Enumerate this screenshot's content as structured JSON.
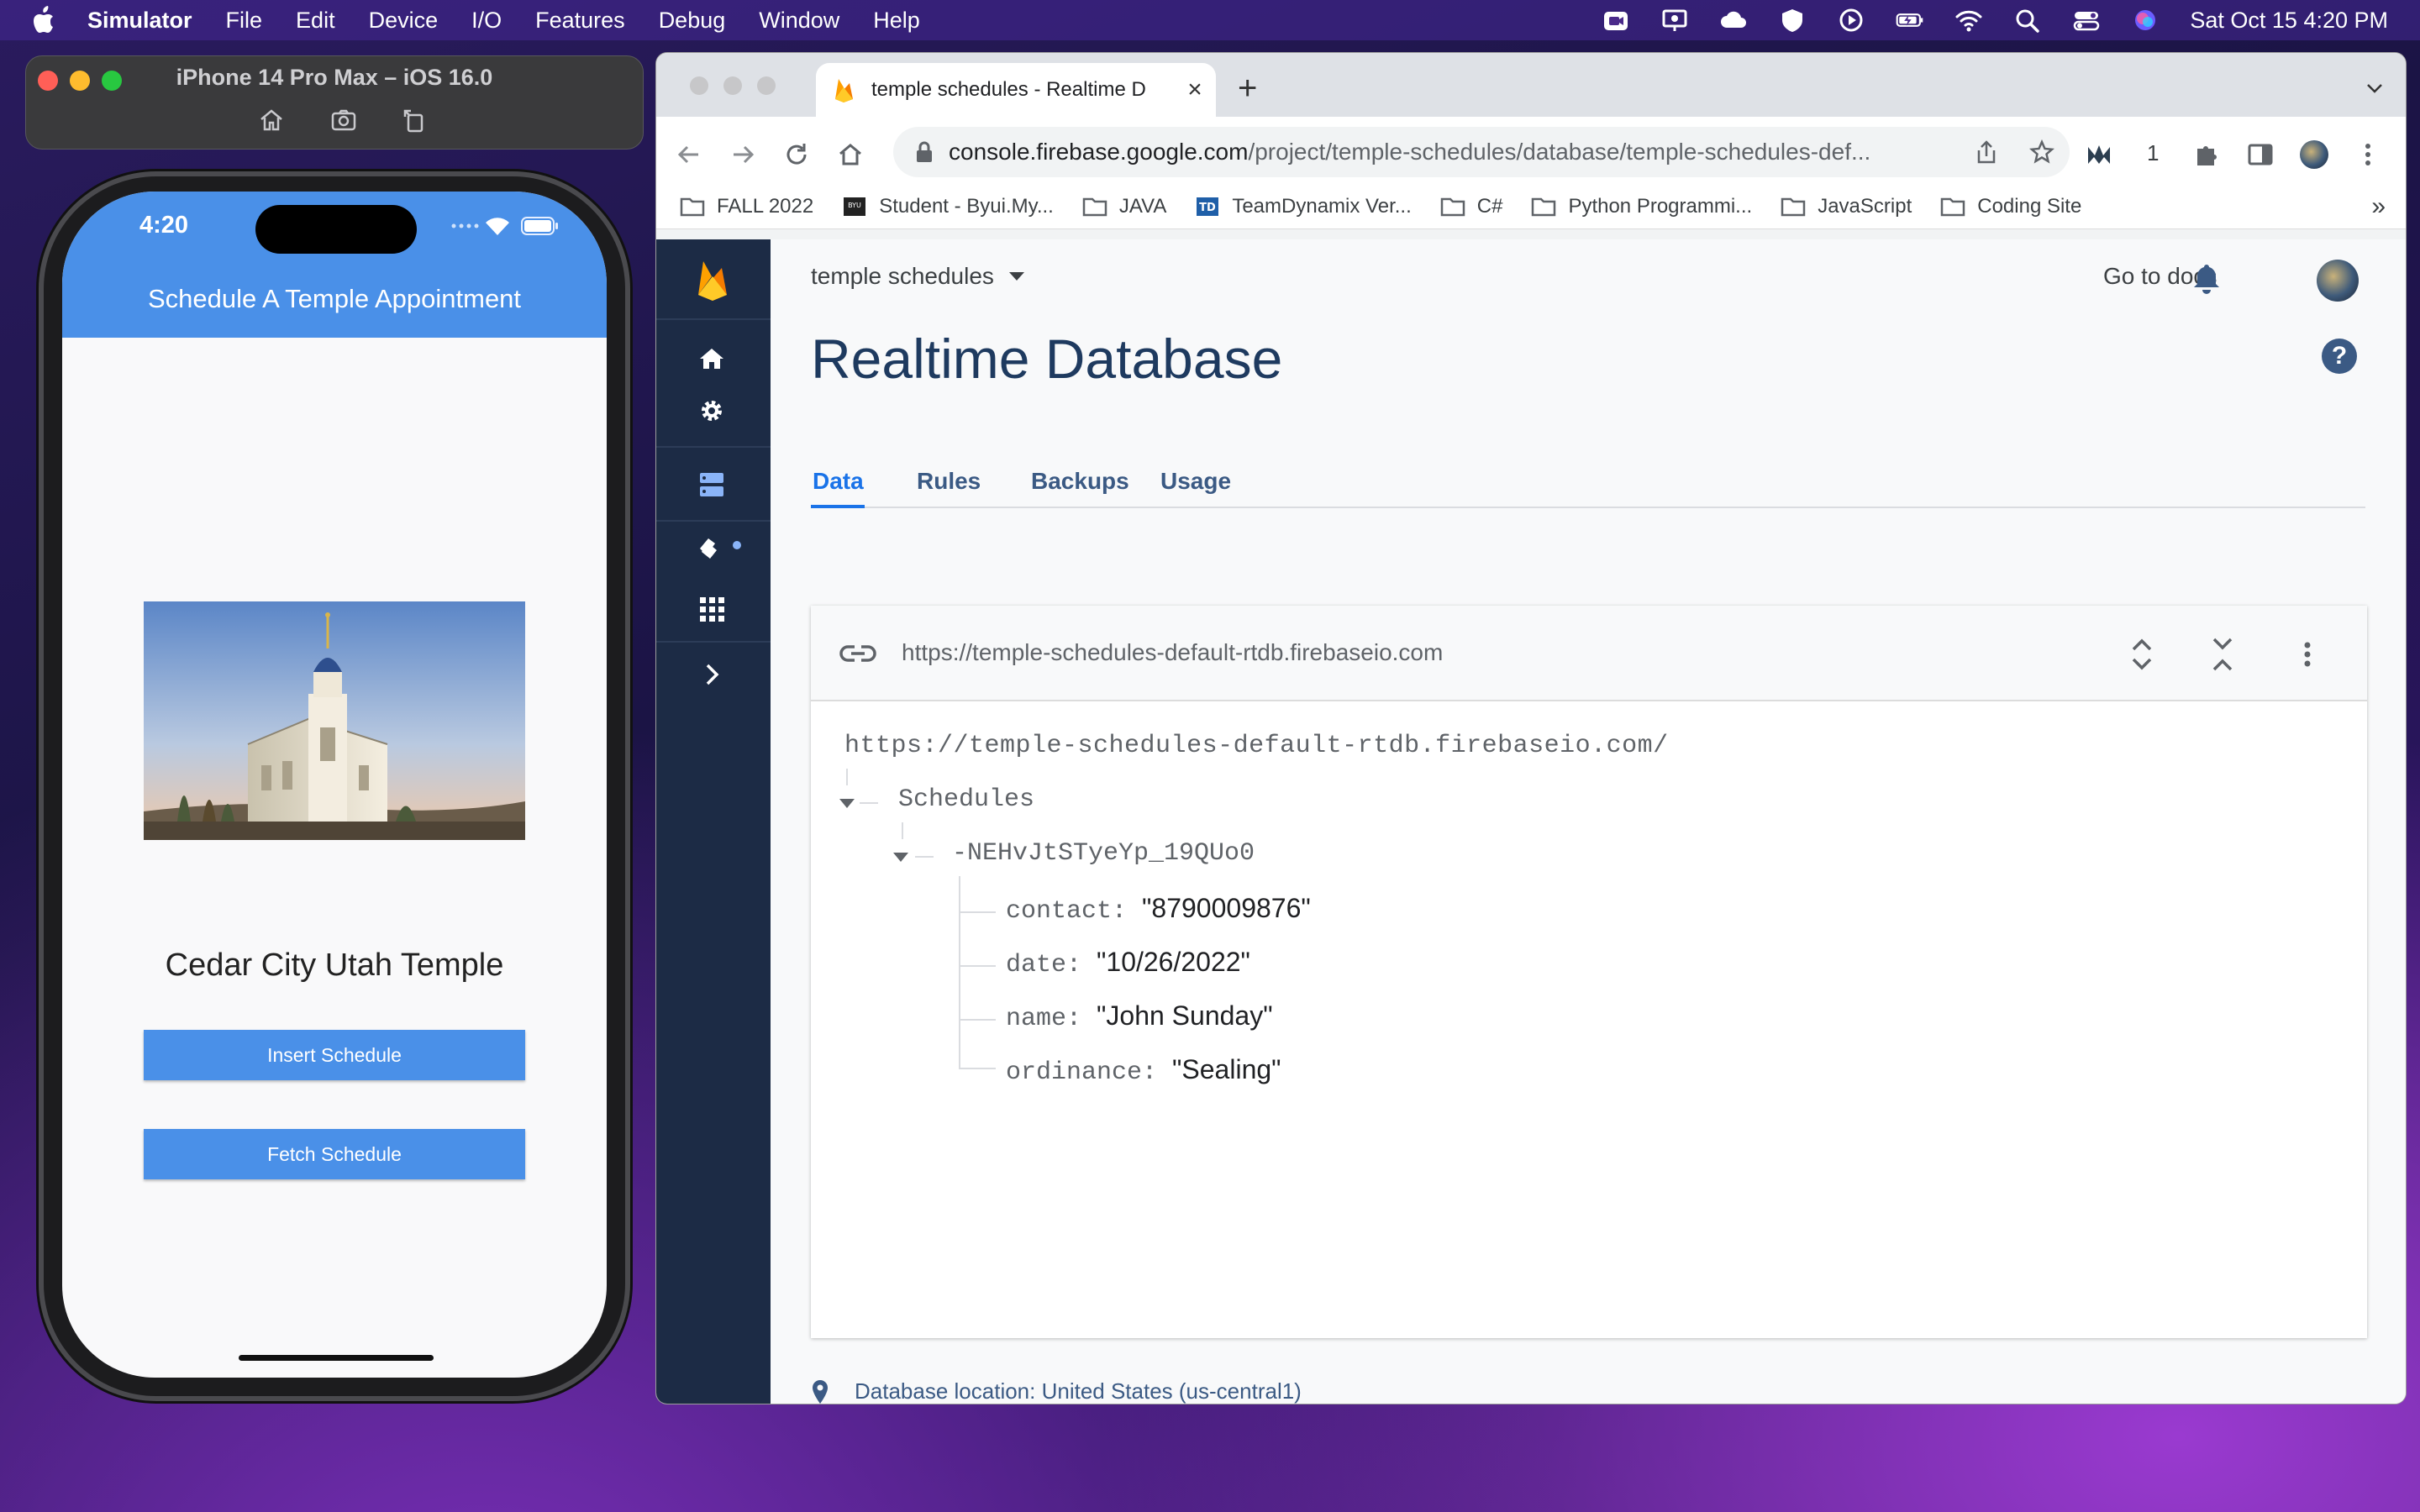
{
  "menubar": {
    "app_name": "Simulator",
    "items": [
      "File",
      "Edit",
      "Device",
      "I/O",
      "Features",
      "Debug",
      "Window",
      "Help"
    ],
    "datetime": "Sat Oct 15  4:20 PM"
  },
  "simulator": {
    "window_title": "iPhone 14 Pro Max – iOS 16.0",
    "status_time": "4:20",
    "app_bar_title": "Schedule A Temple Appointment",
    "temple_name": "Cedar City Utah Temple",
    "insert_button": "Insert Schedule",
    "fetch_button": "Fetch Schedule"
  },
  "browser": {
    "tab_title": "temple schedules - Realtime D",
    "url_host": "console.firebase.google.com",
    "url_path": "/project/temple-schedules/database/temple-schedules-def...",
    "extension_count": "1",
    "bookmarks": [
      "FALL 2022",
      "Student - Byui.My...",
      "JAVA",
      "TeamDynamix Ver...",
      "C#",
      "Python Programmi...",
      "JavaScript",
      "Coding Site"
    ],
    "bookmark_more": "»"
  },
  "firebase": {
    "project_name": "temple schedules",
    "go_to_docs": "Go to docs",
    "page_title": "Realtime Database",
    "help": "?",
    "tabs": [
      "Data",
      "Rules",
      "Backups",
      "Usage"
    ],
    "card_url": "https://temple-schedules-default-rtdb.firebaseio.com",
    "tree_root": "https://temple-schedules-default-rtdb.firebaseio.com/",
    "node_schedules": "Schedules",
    "node_id": "-NEHvJtSTyeYp_19QUo0",
    "fields": [
      {
        "key": "contact",
        "value": "\"8790009876\""
      },
      {
        "key": "date",
        "value": "\"10/26/2022\""
      },
      {
        "key": "name",
        "value": "\"John Sunday\""
      },
      {
        "key": "ordinance",
        "value": "\"Sealing\""
      }
    ],
    "location": "Database location: United States (us-central1)"
  },
  "colors": {
    "firebase_sidebar": "#1c2b45",
    "app_blue": "#4a90e8",
    "tab_active": "#1a73e8",
    "title_navy": "#1e3a5f"
  }
}
